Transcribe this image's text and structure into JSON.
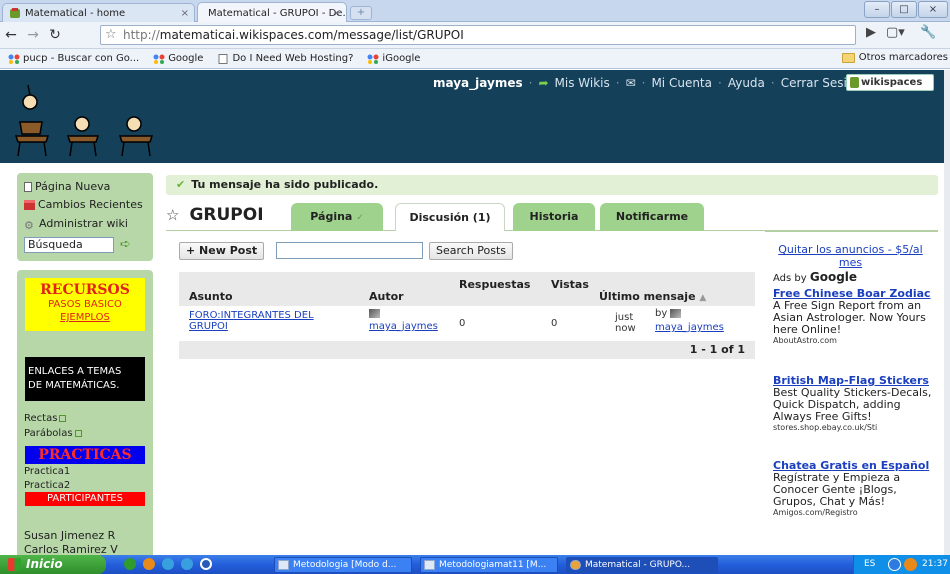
{
  "browser": {
    "tabs": [
      {
        "title": "Matematical - home",
        "close": "×"
      },
      {
        "title": "Matematical - GRUPOI - De...",
        "close": "×"
      }
    ],
    "new_tab": "+",
    "window_buttons": [
      "–",
      "□",
      "×"
    ],
    "url_prefix": "http://",
    "url_main": "matematicai.wikispaces.com/message/list/GRUPOI",
    "bookmarks": [
      "pucp - Buscar con Go...",
      "Google",
      "Do I Need Web Hosting?",
      "iGoogle"
    ],
    "other_bookmarks": "Otros marcadores"
  },
  "header": {
    "username": "maya_jaymes",
    "links": [
      "Mis Wikis",
      "Mi Cuenta",
      "Ayuda",
      "Cerrar Sesión"
    ],
    "logo": "wikispaces"
  },
  "sidebar": {
    "items": [
      {
        "label": "Página Nueva"
      },
      {
        "label": "Cambios Recientes"
      },
      {
        "label": "Administrar wiki"
      }
    ],
    "search_value": "Búsqueda",
    "recursos_title": "RECURSOS",
    "recursos_links": [
      "PASOS BASICO",
      "EJEMPLOS"
    ],
    "enlaces": [
      "ENLACES A TEMAS",
      "DE MATEMÁTICAS."
    ],
    "topic_links": [
      "Rectas",
      "Parábolas"
    ],
    "practicas_title": "PRACTICAS",
    "practicas_links": [
      "Practica1",
      "Practica2"
    ],
    "participantes_title": "PARTICIPANTES",
    "participants": [
      "Susan Jimenez R",
      "Carlos Ramirez V"
    ]
  },
  "notice": "Tu mensaje ha sido publicado.",
  "page_title": "GRUPOI",
  "tabs": [
    "Página",
    "Discusión (1)",
    "Historia",
    "Notificarme"
  ],
  "controls": {
    "new_post": "+ New Post",
    "search_input": "",
    "search_posts": "Search Posts"
  },
  "table": {
    "headers": [
      "Asunto",
      "Autor",
      "Respuestas",
      "Vistas",
      "Último mensaje"
    ],
    "rows": [
      {
        "subject_line1": "FORO:INTEGRANTES DEL",
        "subject_line2": "GRUPOI",
        "author": "maya_jaymes",
        "replies": "0",
        "views": "0",
        "last_time_1": "just",
        "last_time_2": "now",
        "last_by": "by",
        "last_author": "maya_jaymes"
      }
    ],
    "pagination": "1 - 1 of 1"
  },
  "ads": {
    "remove": "Quitar los anuncios - $5/al mes",
    "ads_by": "Ads by",
    "ads_brand": "Google",
    "items": [
      {
        "title": "Free Chinese Boar Zodiac",
        "text": "A Free Sign Report from an Asian Astrologer. Now Yours here Online!",
        "url": "AboutAstro.com"
      },
      {
        "title": "British Map-Flag Stickers",
        "text": "Best Quality Stickers-Decals, Quick Dispatch, adding Always Free Gifts!",
        "url": "stores.shop.ebay.co.uk/Sti"
      },
      {
        "title": "Chatea Gratis en Español",
        "text": "Regístrate y Empieza a Conocer Gente ¡Blogs, Grupos, Chat y Más!",
        "url": "Amigos.com/Registro"
      }
    ]
  },
  "taskbar": {
    "start": "Inicio",
    "tasks": [
      "Metodologia [Modo d...",
      "Metodologiamat11 [M...",
      "Matematical - GRUPO..."
    ],
    "lang": "ES",
    "time": "21:37"
  }
}
